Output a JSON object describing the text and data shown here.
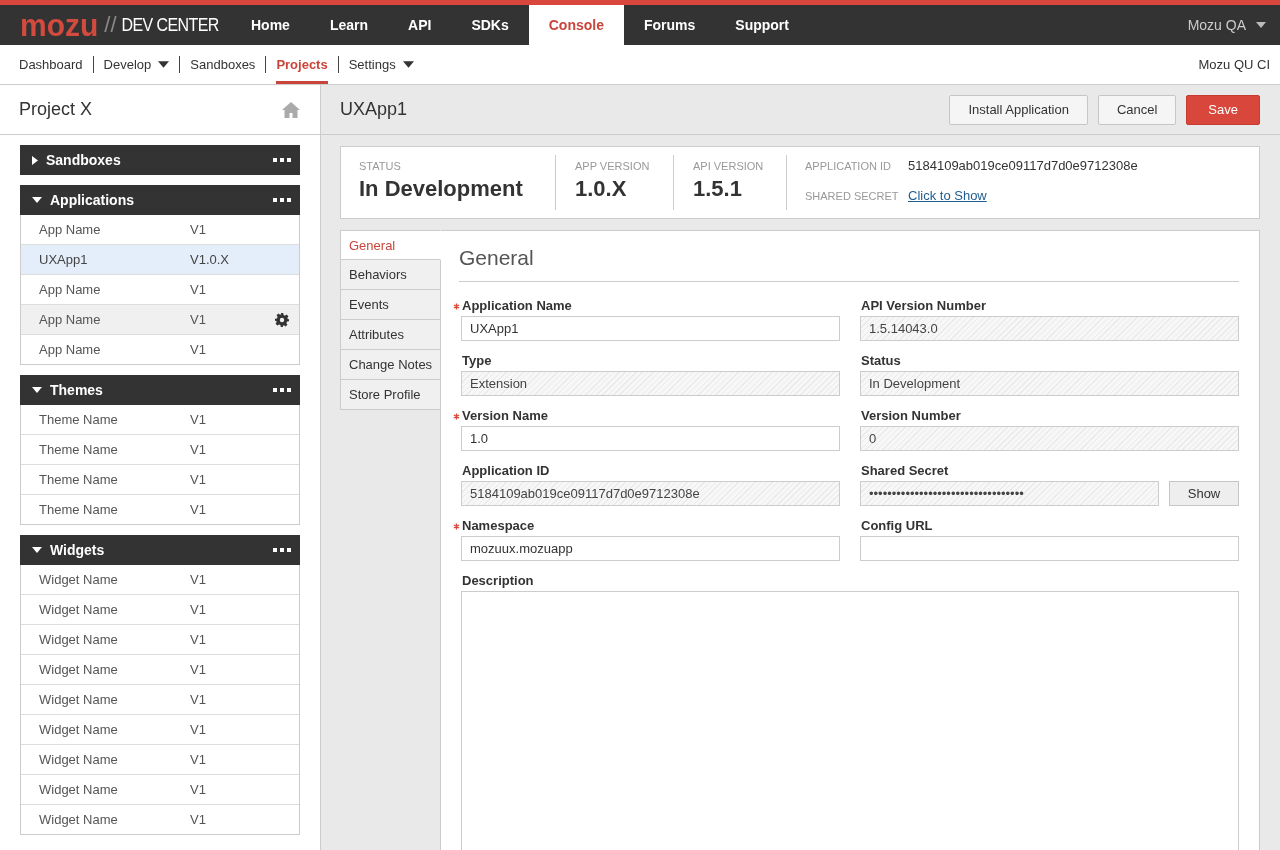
{
  "top_nav": {
    "logo": {
      "brand": "mozu",
      "separator": "//",
      "product": "DEV CENTER"
    },
    "items": [
      {
        "label": "Home",
        "selected": false
      },
      {
        "label": "Learn",
        "selected": false
      },
      {
        "label": "API",
        "selected": false
      },
      {
        "label": "SDKs",
        "selected": false
      },
      {
        "label": "Console",
        "selected": true
      },
      {
        "label": "Forums",
        "selected": false
      },
      {
        "label": "Support",
        "selected": false
      }
    ],
    "account": "Mozu QA"
  },
  "sub_nav": {
    "items": [
      {
        "label": "Dashboard",
        "selected": false,
        "dropdown": false
      },
      {
        "label": "Develop",
        "selected": false,
        "dropdown": true
      },
      {
        "label": "Sandboxes",
        "selected": false,
        "dropdown": false
      },
      {
        "label": "Projects",
        "selected": true,
        "dropdown": false
      },
      {
        "label": "Settings",
        "selected": false,
        "dropdown": true
      }
    ],
    "tenant": "Mozu QU CI"
  },
  "sidebar": {
    "title": "Project X",
    "sections": [
      {
        "title": "Sandboxes",
        "expanded": false
      },
      {
        "title": "Applications",
        "expanded": true,
        "rows": [
          {
            "name": "App Name",
            "version": "V1",
            "selected": false,
            "hovered": false
          },
          {
            "name": "UXApp1",
            "version": "V1.0.X",
            "selected": true,
            "hovered": false
          },
          {
            "name": "App Name",
            "version": "V1",
            "selected": false,
            "hovered": false
          },
          {
            "name": "App Name",
            "version": "V1",
            "selected": false,
            "hovered": true
          },
          {
            "name": "App Name",
            "version": "V1",
            "selected": false,
            "hovered": false
          }
        ]
      },
      {
        "title": "Themes",
        "expanded": true,
        "rows": [
          {
            "name": "Theme Name",
            "version": "V1",
            "selected": false,
            "hovered": false
          },
          {
            "name": "Theme Name",
            "version": "V1",
            "selected": false,
            "hovered": false
          },
          {
            "name": "Theme Name",
            "version": "V1",
            "selected": false,
            "hovered": false
          },
          {
            "name": "Theme Name",
            "version": "V1",
            "selected": false,
            "hovered": false
          }
        ]
      },
      {
        "title": "Widgets",
        "expanded": true,
        "rows": [
          {
            "name": "Widget Name",
            "version": "V1",
            "selected": false,
            "hovered": false
          },
          {
            "name": "Widget Name",
            "version": "V1",
            "selected": false,
            "hovered": false
          },
          {
            "name": "Widget Name",
            "version": "V1",
            "selected": false,
            "hovered": false
          },
          {
            "name": "Widget Name",
            "version": "V1",
            "selected": false,
            "hovered": false
          },
          {
            "name": "Widget Name",
            "version": "V1",
            "selected": false,
            "hovered": false
          },
          {
            "name": "Widget Name",
            "version": "V1",
            "selected": false,
            "hovered": false
          },
          {
            "name": "Widget Name",
            "version": "V1",
            "selected": false,
            "hovered": false
          },
          {
            "name": "Widget Name",
            "version": "V1",
            "selected": false,
            "hovered": false
          },
          {
            "name": "Widget Name",
            "version": "V1",
            "selected": false,
            "hovered": false
          }
        ]
      }
    ]
  },
  "main": {
    "title": "UXApp1",
    "actions": [
      {
        "label": "Install Application",
        "kind": "default"
      },
      {
        "label": "Cancel",
        "kind": "default"
      },
      {
        "label": "Save",
        "kind": "primary"
      }
    ],
    "summary": {
      "stats": [
        {
          "label": "STATUS",
          "value": "In Development"
        },
        {
          "label": "APP VERSION",
          "value": "1.0.X"
        },
        {
          "label": "API VERSION",
          "value": "1.5.1"
        }
      ],
      "details": [
        {
          "label": "APPLICATION ID",
          "value": "5184109ab019ce09117d7d0e9712308e",
          "kind": "text"
        },
        {
          "label": "SHARED SECRET",
          "value": "Click to Show",
          "kind": "link"
        }
      ]
    },
    "tabs": [
      {
        "label": "General",
        "selected": true
      },
      {
        "label": "Behaviors",
        "selected": false
      },
      {
        "label": "Events",
        "selected": false
      },
      {
        "label": "Attributes",
        "selected": false
      },
      {
        "label": "Change Notes",
        "selected": false
      },
      {
        "label": "Store Profile",
        "selected": false
      }
    ],
    "form": {
      "heading": "General",
      "fields": [
        {
          "kind": "input",
          "label": "Application Name",
          "value": "UXApp1",
          "required": true,
          "readonly": false
        },
        {
          "kind": "input",
          "label": "API Version Number",
          "value": "1.5.14043.0",
          "required": false,
          "readonly": true
        },
        {
          "kind": "input",
          "label": "Type",
          "value": "Extension",
          "required": false,
          "readonly": true
        },
        {
          "kind": "input",
          "label": "Status",
          "value": "In Development",
          "required": false,
          "readonly": true
        },
        {
          "kind": "input",
          "label": "Version Name",
          "value": "1.0",
          "required": true,
          "readonly": false
        },
        {
          "kind": "input",
          "label": "Version Number",
          "value": "0",
          "required": false,
          "readonly": true
        },
        {
          "kind": "input",
          "label": "Application ID",
          "value": "5184109ab019ce09117d7d0e9712308e",
          "required": false,
          "readonly": true
        },
        {
          "kind": "input",
          "label": "Shared Secret",
          "value": "••••••••••••••••••••••••••••••••••",
          "required": false,
          "readonly": true,
          "action": "Show"
        },
        {
          "kind": "input",
          "label": "Namespace",
          "value": "mozuux.mozuapp",
          "required": true,
          "readonly": false
        },
        {
          "kind": "input",
          "label": "Config URL",
          "required": false,
          "readonly": false
        },
        {
          "kind": "textarea",
          "label": "Description",
          "required": false,
          "readonly": false
        }
      ]
    }
  }
}
